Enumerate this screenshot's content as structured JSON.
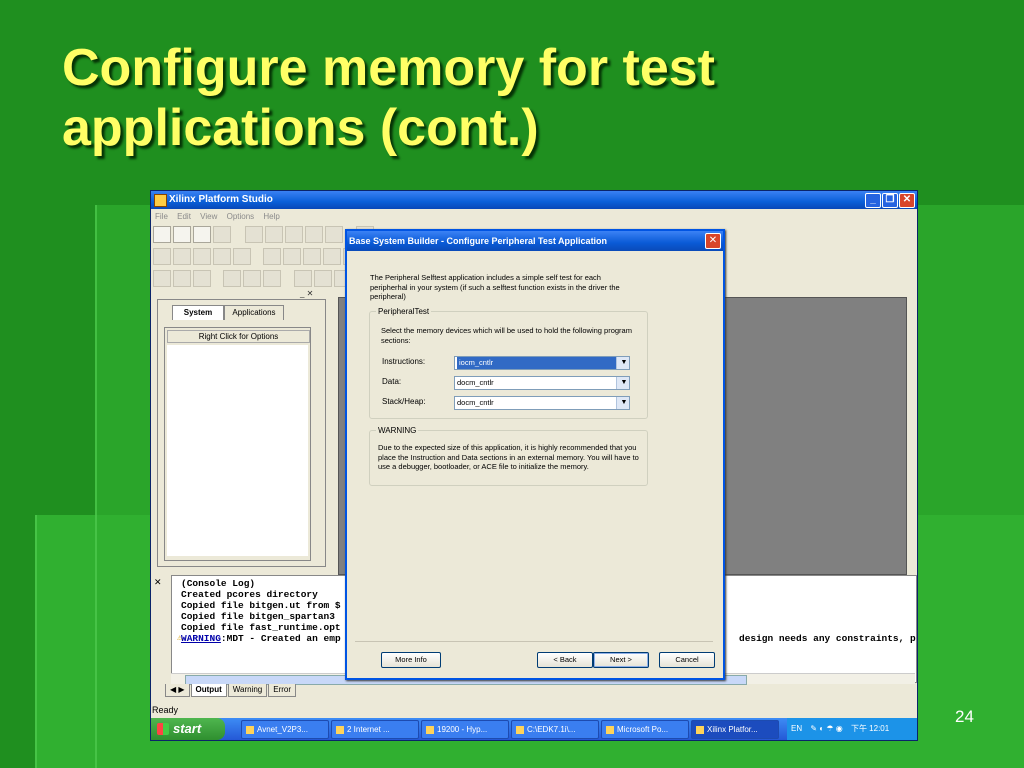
{
  "slide": {
    "title": "Configure memory for test applications (cont.)",
    "number": "24"
  },
  "window": {
    "title": "Xilinx Platform Studio",
    "menu": [
      "File",
      "Edit",
      "View",
      "Options",
      "Help"
    ],
    "panel_tabs": [
      "System",
      "Applications"
    ],
    "right_click": "Right Click for Options",
    "console_lines": [
      "(Console Log)",
      "Created pcores directory",
      "Copied file bitgen.ut from $",
      "Copied file bitgen_spartan3",
      "Copied file fast_runtime.opt"
    ],
    "console_warning_word": "WARNING",
    "console_warning_rest": ":MDT - Created an emp",
    "console_warning_tail": "design needs any constraints, pl",
    "output_tabs": [
      "Output",
      "Warning",
      "Error"
    ],
    "status": "Ready"
  },
  "dialog": {
    "title": "Base System Builder - Configure Peripheral Test Application",
    "intro": "The Peripheral Selftest application includes a simple self test for each peripherhal in your system (if such a selftest function exists in the driver the peripheral)",
    "peripheral_legend": "PeripheralTest",
    "peripheral_hint": "Select the memory devices which will be used to hold the following program sections:",
    "fields": [
      {
        "label": "Instructions:",
        "value": "iocm_cntlr"
      },
      {
        "label": "Data:",
        "value": "docm_cntlr"
      },
      {
        "label": "Stack/Heap:",
        "value": "docm_cntlr"
      }
    ],
    "warning_legend": "WARNING",
    "warning_text": "Due to the expected size of this application, it is highly recommended that you place the Instruction and Data sections in an external memory.  You will have to use a debugger, bootloader, or ACE file to initialize the memory.",
    "buttons": {
      "more_info": "More Info",
      "back": "< Back",
      "next": "Next >",
      "cancel": "Cancel"
    }
  },
  "taskbar": {
    "start": "start",
    "tasks": [
      "Avnet_V2P3...",
      "2 Internet ...",
      "19200 - Hyp...",
      "C:\\EDK7.1i\\...",
      "Microsoft Po...",
      "Xilinx Platfor..."
    ],
    "lang": "EN",
    "clock": "下午 12:01"
  }
}
